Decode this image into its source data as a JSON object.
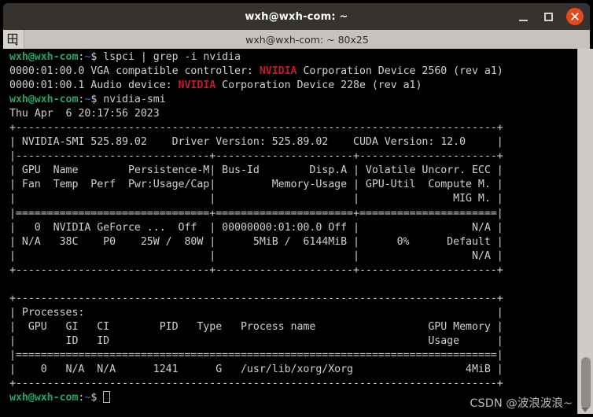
{
  "window": {
    "title": "wxh@wxh-com: ~",
    "controls": {
      "minimize_label": "Minimize",
      "maximize_label": "Maximize",
      "close_label": "Close"
    }
  },
  "tabbar": {
    "new_tab_label": "New Tab / Split",
    "tab_title": "wxh@wxh-com: ~ 80x25"
  },
  "colors": {
    "titlebar_bg": "#35322f",
    "tabbar_bg": "#c6c2bd",
    "terminal_bg": "#000000",
    "terminal_fg": "#d0cfcc",
    "prompt_green": "#26a269",
    "path_blue": "#2a7bde",
    "nvidia_red": "#c01c28",
    "close_button": "#e8491b",
    "scrollbar_track": "#cfcbc6",
    "scrollbar_thumb": "#8f8b86",
    "watermark": "#b9b9b9"
  },
  "terminal": {
    "size": "80x25",
    "prompt": {
      "user_host": "wxh@wxh-com",
      "separator": ":",
      "path": "~",
      "sigil": "$"
    },
    "commands": [
      "lspci | grep -i nvidia",
      "nvidia-smi"
    ],
    "lspci_output": [
      {
        "prefix": "0000:01:00.0 VGA compatible controller: ",
        "vendor": "NVIDIA",
        "suffix": " Corporation Device 2560 (rev a1)"
      },
      {
        "prefix": "0000:01:00.1 Audio device: ",
        "vendor": "NVIDIA",
        "suffix": " Corporation Device 228e (rev a1)"
      }
    ],
    "nvidia_smi": {
      "timestamp": "Thu Apr  6 20:17:56 2023",
      "header": {
        "smi_version": "NVIDIA-SMI 525.89.02",
        "driver_version": "Driver Version: 525.89.02",
        "cuda_version": "CUDA Version: 12.0"
      },
      "column_headers": [
        "GPU  Name        Persistence-M| Bus-Id        Disp.A | Volatile Uncorr. ECC",
        "Fan  Temp  Perf  Pwr:Usage/Cap|         Memory-Usage | GPU-Util  Compute M.",
        "                              |                      |               MIG M."
      ],
      "gpu_rows": [
        {
          "index": "0",
          "name": "NVIDIA GeForce ...",
          "persistence_m": "Off",
          "bus_id": "00000000:01:00.0",
          "disp_a": "Off",
          "ecc": "N/A",
          "fan": "N/A",
          "temp": "38C",
          "perf": "P0",
          "pwr_usage_cap": "25W /  80W",
          "memory_usage": "5MiB /  6144MiB",
          "gpu_util": "0%",
          "compute_m": "Default",
          "mig_m": "N/A"
        }
      ],
      "processes": {
        "title": "Processes:",
        "column_headers": [
          "GPU   GI   CI        PID   Type   Process name                  GPU Memory",
          "      ID   ID                                                   Usage"
        ],
        "rows": [
          {
            "gpu": "0",
            "gi_id": "N/A",
            "ci_id": "N/A",
            "pid": "1241",
            "type": "G",
            "process_name": "/usr/lib/xorg/Xorg",
            "gpu_memory_usage": "4MiB"
          }
        ]
      }
    },
    "lines": [
      {
        "id": "l01",
        "segments": [
          {
            "cls": "g",
            "t": "wxh@wxh-com"
          },
          {
            "cls": "w",
            "t": ":"
          },
          {
            "cls": "b",
            "t": "~"
          },
          {
            "cls": "w",
            "t": "$ lspci | grep -i nvidia"
          }
        ]
      },
      {
        "id": "l02",
        "segments": [
          {
            "cls": "w",
            "t": "0000:01:00.0 VGA compatible controller: "
          },
          {
            "cls": "r",
            "t": "NVIDIA"
          },
          {
            "cls": "w",
            "t": " Corporation Device 2560 (rev a1)"
          }
        ]
      },
      {
        "id": "l03",
        "segments": [
          {
            "cls": "w",
            "t": "0000:01:00.1 Audio device: "
          },
          {
            "cls": "r",
            "t": "NVIDIA"
          },
          {
            "cls": "w",
            "t": " Corporation Device 228e (rev a1)"
          }
        ]
      },
      {
        "id": "l04",
        "segments": [
          {
            "cls": "g",
            "t": "wxh@wxh-com"
          },
          {
            "cls": "w",
            "t": ":"
          },
          {
            "cls": "b",
            "t": "~"
          },
          {
            "cls": "w",
            "t": "$ nvidia-smi"
          }
        ]
      },
      {
        "id": "l05",
        "segments": [
          {
            "cls": "w",
            "t": "Thu Apr  6 20:17:56 2023"
          }
        ]
      },
      {
        "id": "l06",
        "segments": [
          {
            "cls": "w",
            "t": "+-----------------------------------------------------------------------------+"
          }
        ]
      },
      {
        "id": "l07",
        "segments": [
          {
            "cls": "w",
            "t": "| NVIDIA-SMI 525.89.02    Driver Version: 525.89.02    CUDA Version: 12.0     |"
          }
        ]
      },
      {
        "id": "l08",
        "segments": [
          {
            "cls": "w",
            "t": "|-------------------------------+----------------------+----------------------+"
          }
        ]
      },
      {
        "id": "l09",
        "segments": [
          {
            "cls": "w",
            "t": "| GPU  Name        Persistence-M| Bus-Id        Disp.A | Volatile Uncorr. ECC |"
          }
        ]
      },
      {
        "id": "l10",
        "segments": [
          {
            "cls": "w",
            "t": "| Fan  Temp  Perf  Pwr:Usage/Cap|         Memory-Usage | GPU-Util  Compute M. |"
          }
        ]
      },
      {
        "id": "l11",
        "segments": [
          {
            "cls": "w",
            "t": "|                               |                      |               MIG M. |"
          }
        ]
      },
      {
        "id": "l12",
        "segments": [
          {
            "cls": "w",
            "t": "|===============================+======================+======================|"
          }
        ]
      },
      {
        "id": "l13",
        "segments": [
          {
            "cls": "w",
            "t": "|   0  NVIDIA GeForce ...  Off  | 00000000:01:00.0 Off |                  N/A |"
          }
        ]
      },
      {
        "id": "l14",
        "segments": [
          {
            "cls": "w",
            "t": "| N/A   38C    P0    25W /  80W |      5MiB /  6144MiB |      0%      Default |"
          }
        ]
      },
      {
        "id": "l15",
        "segments": [
          {
            "cls": "w",
            "t": "|                               |                      |                  N/A |"
          }
        ]
      },
      {
        "id": "l16",
        "segments": [
          {
            "cls": "w",
            "t": "+-------------------------------+----------------------+----------------------+"
          }
        ]
      },
      {
        "id": "l17",
        "segments": [
          {
            "cls": "w",
            "t": ""
          }
        ]
      },
      {
        "id": "l18",
        "segments": [
          {
            "cls": "w",
            "t": "+-----------------------------------------------------------------------------+"
          }
        ]
      },
      {
        "id": "l19",
        "segments": [
          {
            "cls": "w",
            "t": "| Processes:                                                                  |"
          }
        ]
      },
      {
        "id": "l20",
        "segments": [
          {
            "cls": "w",
            "t": "|  GPU   GI   CI        PID   Type   Process name                  GPU Memory |"
          }
        ]
      },
      {
        "id": "l21",
        "segments": [
          {
            "cls": "w",
            "t": "|        ID   ID                                                   Usage      |"
          }
        ]
      },
      {
        "id": "l22",
        "segments": [
          {
            "cls": "w",
            "t": "|=============================================================================|"
          }
        ]
      },
      {
        "id": "l23",
        "segments": [
          {
            "cls": "w",
            "t": "|    0   N/A  N/A      1241      G   /usr/lib/xorg/Xorg                  4MiB |"
          }
        ]
      },
      {
        "id": "l24",
        "segments": [
          {
            "cls": "w",
            "t": "+-----------------------------------------------------------------------------+"
          }
        ]
      },
      {
        "id": "l25",
        "segments": [
          {
            "cls": "g",
            "t": "wxh@wxh-com"
          },
          {
            "cls": "w",
            "t": ":"
          },
          {
            "cls": "b",
            "t": "~"
          },
          {
            "cls": "w",
            "t": "$ "
          },
          {
            "cls": "cursor",
            "t": " "
          }
        ]
      }
    ]
  },
  "watermark": {
    "text": "CSDN @波浪波浪~"
  }
}
